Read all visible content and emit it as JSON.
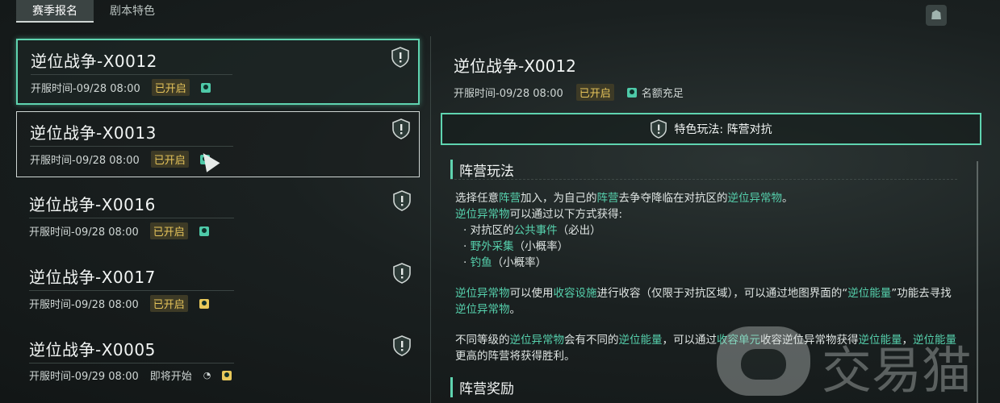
{
  "tabs": [
    {
      "label": "赛季报名"
    },
    {
      "label": "剧本特色"
    }
  ],
  "servers": [
    {
      "name": "逆位战争-X0012",
      "time": "开服时间-09/28 08:00",
      "status": "已开启",
      "status_kind": "open",
      "slot_icon": "person-icon-teal"
    },
    {
      "name": "逆位战争-X0013",
      "time": "开服时间-09/28 08:00",
      "status": "已开启",
      "status_kind": "open",
      "slot_icon": "person-icon-teal"
    },
    {
      "name": "逆位战争-X0016",
      "time": "开服时间-09/28 08:00",
      "status": "已开启",
      "status_kind": "open",
      "slot_icon": "person-icon-teal"
    },
    {
      "name": "逆位战争-X0017",
      "time": "开服时间-09/28 08:00",
      "status": "已开启",
      "status_kind": "open",
      "slot_icon": "person-icon-gold"
    },
    {
      "name": "逆位战争-X0005",
      "time": "开服时间-09/29 08:00",
      "status": "即将开始",
      "status_kind": "soon",
      "slot_icon": "person-icon-gold"
    }
  ],
  "detail": {
    "name": "逆位战争-X0012",
    "time": "开服时间-09/28 08:00",
    "status": "已开启",
    "quota": "名额充足",
    "feature_label": "特色玩法: 阵营对抗",
    "section1_title": "阵营玩法",
    "p1a": "选择任意",
    "p1b": "阵营",
    "p1c": "加入，为自己的",
    "p1d": "阵营",
    "p1e": "去争夺降临在对抗区的",
    "p1f": "逆位异常物",
    "p1g": "。",
    "p2a": "逆位异常物",
    "p2b": "可以通过以下方式获得:",
    "b1a": "· 对抗区的",
    "b1b": "公共事件",
    "b1c": "（必出）",
    "b2a": "· ",
    "b2b": "野外采集",
    "b2c": "（小概率）",
    "b3a": "· ",
    "b3b": "钓鱼",
    "b3c": "（小概率）",
    "p3a": "逆位异常物",
    "p3b": "可以使用",
    "p3c": "收容设施",
    "p3d": "进行收容（仅限于对抗区域），可以通过地图界面的“",
    "p3e": "逆位能量",
    "p3f": "”功能去寻找",
    "p3g": "逆位异常物",
    "p3h": "。",
    "p4a": "不同等级的",
    "p4b": "逆位异常物",
    "p4c": "会有不同的",
    "p4d": "逆位能量",
    "p4e": "，可以通过",
    "p4f": "收容单元",
    "p4g": "收容逆位异常物获得",
    "p4h": "逆位能量",
    "p4i": "，",
    "p4j": "逆位能量",
    "p4k": "更高的阵营将获得胜利。",
    "section2_title": "阵营奖励"
  },
  "watermark": "交易猫",
  "colors": {
    "accent": "#5fd4b0",
    "status_open": "#e6c45a",
    "highlight": "#56d1ad"
  }
}
